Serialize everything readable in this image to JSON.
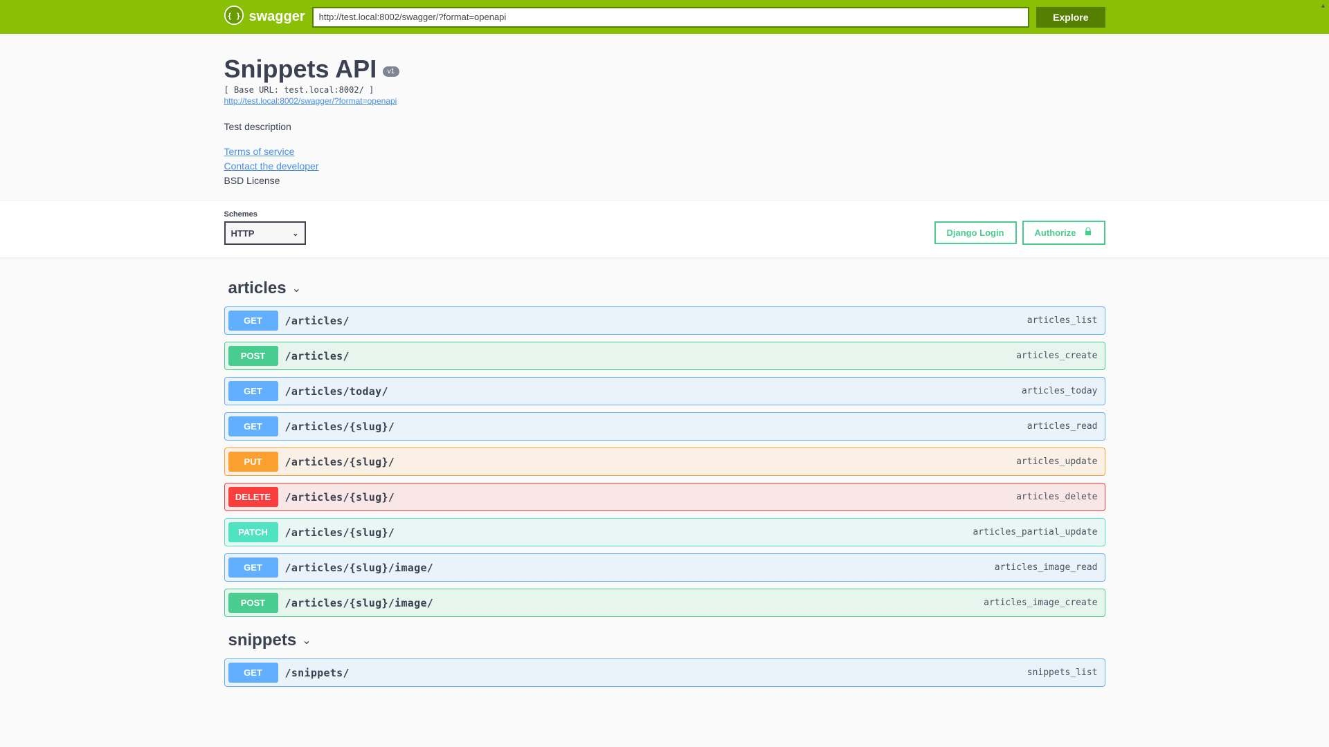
{
  "topbar": {
    "brand": "swagger",
    "url_value": "http://test.local:8002/swagger/?format=openapi",
    "explore_label": "Explore"
  },
  "info": {
    "title": "Snippets API",
    "version": "v1",
    "base_url": "[ Base URL: test.local:8002/ ]",
    "spec_url": "http://test.local:8002/swagger/?format=openapi",
    "description": "Test description",
    "terms_label": "Terms of service",
    "contact_label": "Contact the developer",
    "license": "BSD License"
  },
  "schemes": {
    "label": "Schemes",
    "selected": "HTTP",
    "login_label": "Django Login",
    "authorize_label": "Authorize"
  },
  "tags": {
    "articles": "articles",
    "snippets": "snippets"
  },
  "ops": {
    "articles": [
      {
        "method": "GET",
        "path": "/articles/",
        "id": "articles_list"
      },
      {
        "method": "POST",
        "path": "/articles/",
        "id": "articles_create"
      },
      {
        "method": "GET",
        "path": "/articles/today/",
        "id": "articles_today"
      },
      {
        "method": "GET",
        "path": "/articles/{slug}/",
        "id": "articles_read"
      },
      {
        "method": "PUT",
        "path": "/articles/{slug}/",
        "id": "articles_update"
      },
      {
        "method": "DELETE",
        "path": "/articles/{slug}/",
        "id": "articles_delete"
      },
      {
        "method": "PATCH",
        "path": "/articles/{slug}/",
        "id": "articles_partial_update"
      },
      {
        "method": "GET",
        "path": "/articles/{slug}/image/",
        "id": "articles_image_read"
      },
      {
        "method": "POST",
        "path": "/articles/{slug}/image/",
        "id": "articles_image_create"
      }
    ],
    "snippets": [
      {
        "method": "GET",
        "path": "/snippets/",
        "id": "snippets_list"
      }
    ]
  }
}
